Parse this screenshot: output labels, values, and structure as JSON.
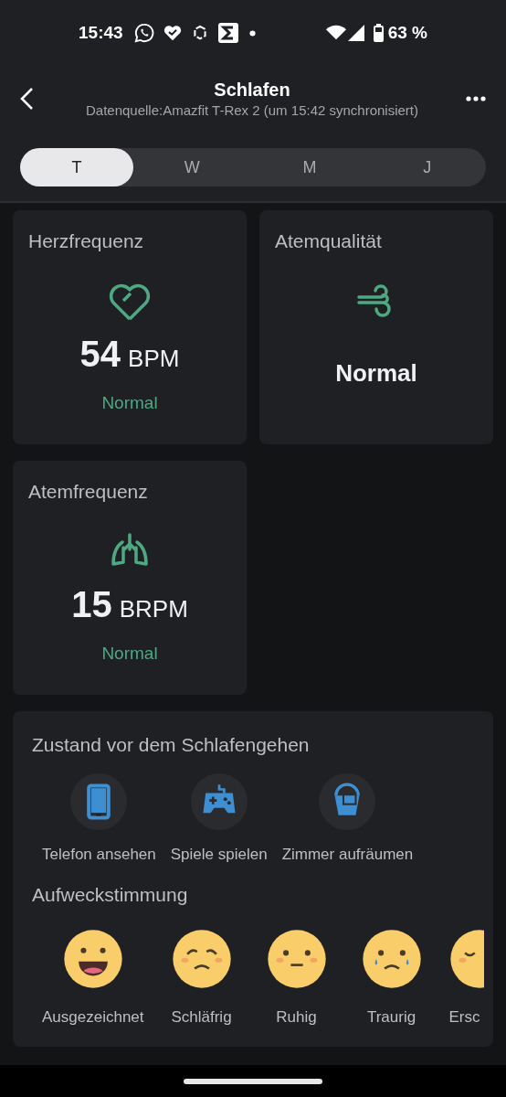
{
  "status_bar": {
    "time": "15:43",
    "battery": "63 %"
  },
  "header": {
    "title": "Schlafen",
    "subtitle": "Datenquelle:Amazfit T-Rex 2 (um 15:42 synchronisiert)"
  },
  "tabs": [
    {
      "label": "T",
      "selected": true
    },
    {
      "label": "W",
      "selected": false
    },
    {
      "label": "M",
      "selected": false
    },
    {
      "label": "J",
      "selected": false
    }
  ],
  "cards": [
    {
      "kind": "reading",
      "title": "Herzfrequenz",
      "value": "54",
      "unit": "BPM",
      "status": "Normal"
    },
    {
      "kind": "label",
      "title": "Atemqualität",
      "value": "Normal"
    },
    {
      "kind": "reading",
      "title": "Atemfrequenz",
      "value": "15",
      "unit": "BRPM",
      "status": "Normal"
    }
  ],
  "pre_sleep": {
    "title": "Zustand vor dem Schlafengehen",
    "items": [
      {
        "label": "Telefon ansehen"
      },
      {
        "label": "Spiele spielen"
      },
      {
        "label": "Zimmer aufräumen"
      }
    ]
  },
  "wake_mood": {
    "title": "Aufweckstimmung",
    "items": [
      {
        "label": "Ausgezeichnet"
      },
      {
        "label": "Schläfrig"
      },
      {
        "label": "Ruhig"
      },
      {
        "label": "Traurig"
      },
      {
        "label": "Ersc"
      }
    ]
  }
}
